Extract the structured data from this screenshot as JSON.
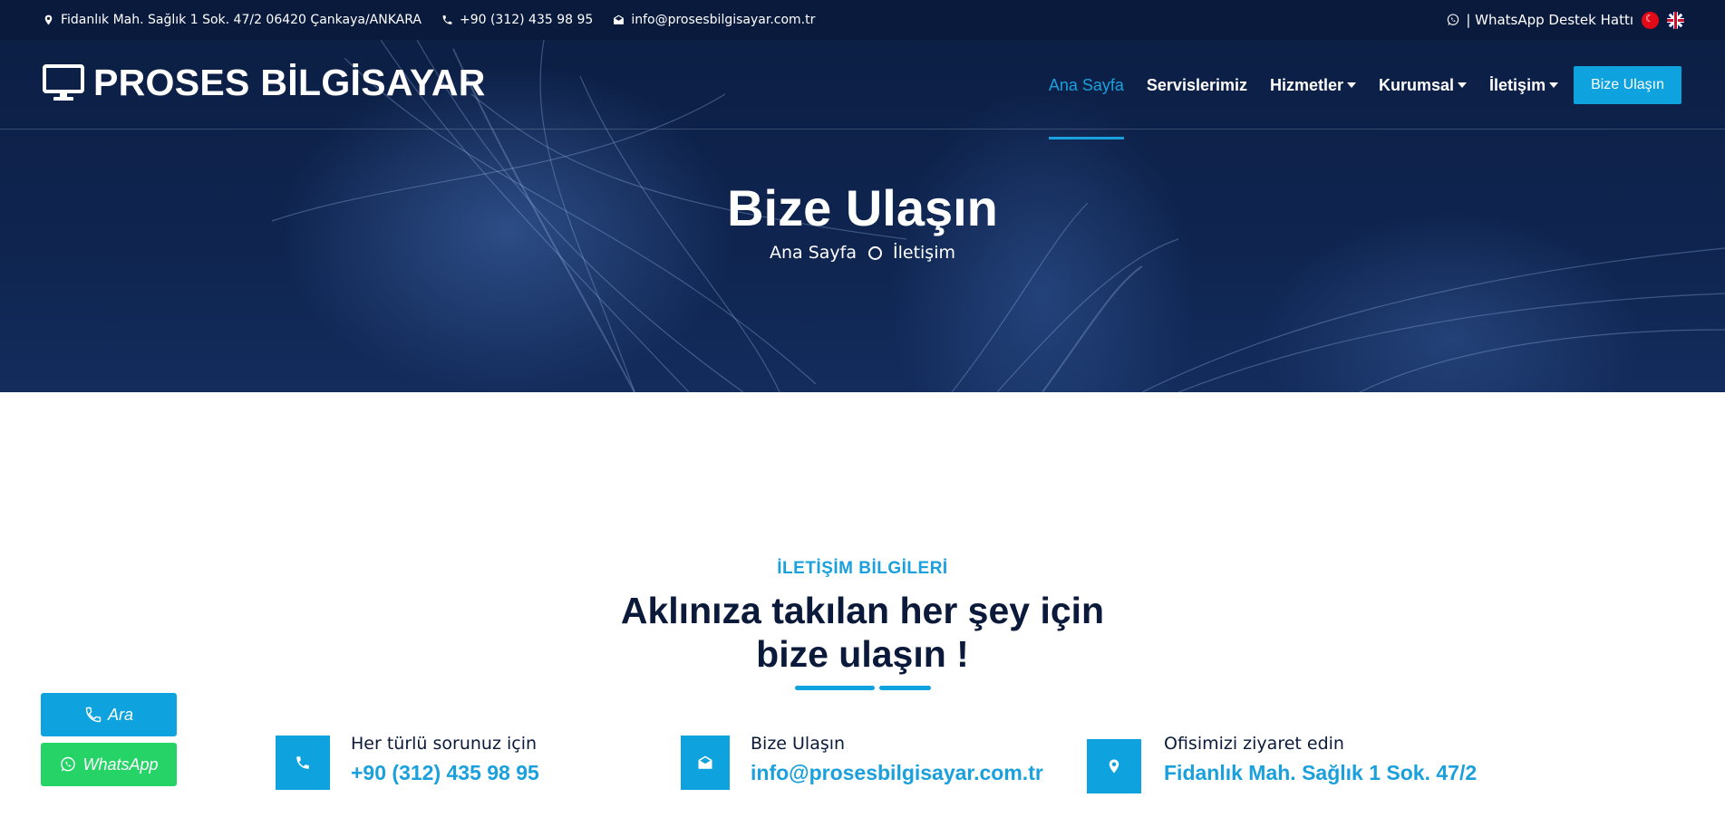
{
  "topbar": {
    "address": "Fidanlık Mah. Sağlık 1 Sok. 47/2 06420 Çankaya/ANKARA",
    "phone": "+90 (312) 435 98 95",
    "email": "info@prosesbilgisayar.com.tr",
    "whatsapp_label": "| WhatsApp Destek Hattı",
    "languages": [
      "tr",
      "en"
    ]
  },
  "brand": {
    "name": "PROSES BİLGİSAYAR",
    "icon": "monitor-icon"
  },
  "nav": {
    "items": [
      {
        "label": "Ana Sayfa",
        "active": true,
        "dropdown": false
      },
      {
        "label": "Servislerimiz",
        "active": false,
        "dropdown": false
      },
      {
        "label": "Hizmetler",
        "active": false,
        "dropdown": true
      },
      {
        "label": "Kurumsal",
        "active": false,
        "dropdown": true
      },
      {
        "label": "İletişim",
        "active": false,
        "dropdown": true
      }
    ],
    "cta": "Bize Ulaşın"
  },
  "hero": {
    "title": "Bize Ulaşın",
    "breadcrumb": [
      "Ana Sayfa",
      "İletişim"
    ]
  },
  "contact": {
    "subtitle": "İLETİŞİM BİLGİLERİ",
    "heading_line1": "Aklınıza takılan her şey için",
    "heading_line2": "bize ulaşın !",
    "items": [
      {
        "icon": "phone-icon",
        "label": "Her türlü sorunuz için",
        "value": "+90 (312) 435 98 95"
      },
      {
        "icon": "envelope-icon",
        "label": "Bize Ulaşın",
        "value": "info@prosesbilgisayar.com.tr"
      },
      {
        "icon": "map-pin-icon",
        "label": "Ofisimizi ziyaret edin",
        "value": "Fidanlık Mah. Sağlık 1 Sok. 47/2"
      }
    ]
  },
  "floating": {
    "call_label": "Ara",
    "whatsapp_label": "WhatsApp"
  },
  "colors": {
    "accent": "#0ea3de",
    "navy": "#0a1a3c",
    "whatsapp": "#25d366"
  }
}
